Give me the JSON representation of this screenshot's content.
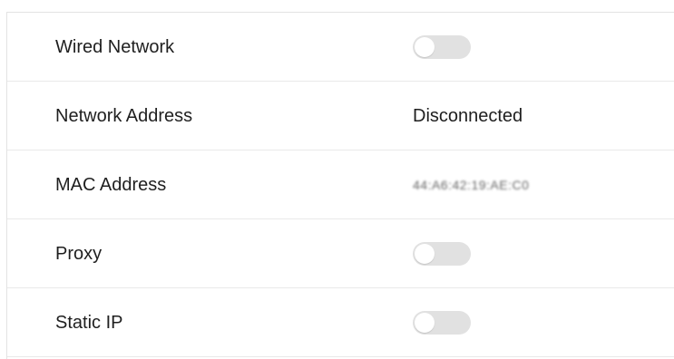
{
  "settings": {
    "rows": [
      {
        "label": "Wired Network",
        "type": "toggle",
        "value": "off"
      },
      {
        "label": "Network Address",
        "type": "text",
        "value": "Disconnected"
      },
      {
        "label": "MAC Address",
        "type": "text",
        "value": "44:A6:42:19:AE:C0"
      },
      {
        "label": "Proxy",
        "type": "toggle",
        "value": "off"
      },
      {
        "label": "Static IP",
        "type": "toggle",
        "value": "off"
      }
    ]
  },
  "colors": {
    "toggle_off_track": "#e1e1e1",
    "toggle_knob": "#ffffff",
    "divider": "#e9e9e9",
    "text": "#1f1f1f"
  }
}
